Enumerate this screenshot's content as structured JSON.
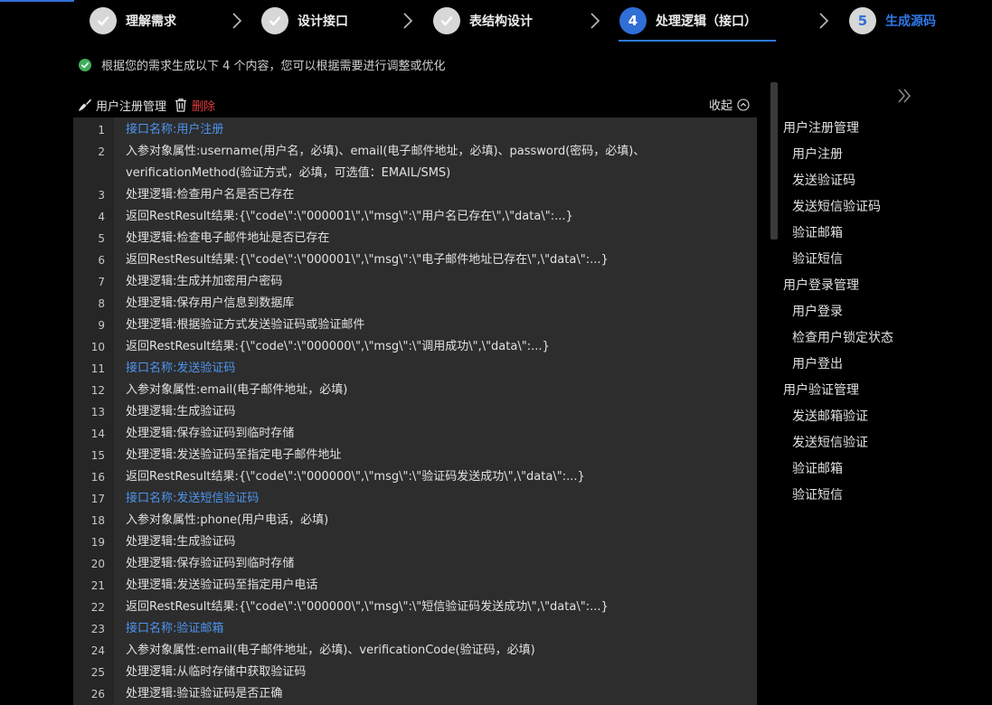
{
  "steps": [
    {
      "label": "理解需求",
      "state": "done"
    },
    {
      "label": "设计接口",
      "state": "done"
    },
    {
      "label": "表结构设计",
      "state": "done"
    },
    {
      "label": "处理逻辑（接口）",
      "number": "4",
      "state": "active"
    },
    {
      "label": "生成源码",
      "number": "5",
      "state": "todo"
    }
  ],
  "status": {
    "text": "根据您的需求生成以下 4 个内容，您可以根据需要进行调整或优化"
  },
  "toolbar": {
    "manage_label": "用户注册管理",
    "delete_label": "删除",
    "collapse_label": "收起"
  },
  "code_lines": [
    {
      "n": "1",
      "text": "接口名称:用户注册",
      "type": "name"
    },
    {
      "n": "2",
      "text": "入参对象属性:username(用户名，必填)、email(电子邮件地址，必填)、password(密码，必填)、verificationMethod(验证方式，必填，可选值：EMAIL/SMS)"
    },
    {
      "n": "3",
      "text": "处理逻辑:检查用户名是否已存在"
    },
    {
      "n": "4",
      "text": "返回RestResult结果:{\\\"code\\\":\\\"000001\\\",\\\"msg\\\":\\\"用户名已存在\\\",\\\"data\\\":...}"
    },
    {
      "n": "5",
      "text": "处理逻辑:检查电子邮件地址是否已存在"
    },
    {
      "n": "6",
      "text": "返回RestResult结果:{\\\"code\\\":\\\"000001\\\",\\\"msg\\\":\\\"电子邮件地址已存在\\\",\\\"data\\\":...}"
    },
    {
      "n": "7",
      "text": "处理逻辑:生成并加密用户密码"
    },
    {
      "n": "8",
      "text": "处理逻辑:保存用户信息到数据库"
    },
    {
      "n": "9",
      "text": "处理逻辑:根据验证方式发送验证码或验证邮件"
    },
    {
      "n": "10",
      "text": "返回RestResult结果:{\\\"code\\\":\\\"000000\\\",\\\"msg\\\":\\\"调用成功\\\",\\\"data\\\":...}"
    },
    {
      "n": "11",
      "text": "接口名称:发送验证码",
      "type": "name"
    },
    {
      "n": "12",
      "text": "入参对象属性:email(电子邮件地址，必填)"
    },
    {
      "n": "13",
      "text": "处理逻辑:生成验证码"
    },
    {
      "n": "14",
      "text": "处理逻辑:保存验证码到临时存储"
    },
    {
      "n": "15",
      "text": "处理逻辑:发送验证码至指定电子邮件地址"
    },
    {
      "n": "16",
      "text": "返回RestResult结果:{\\\"code\\\":\\\"000000\\\",\\\"msg\\\":\\\"验证码发送成功\\\",\\\"data\\\":...}"
    },
    {
      "n": "17",
      "text": "接口名称:发送短信验证码",
      "type": "name"
    },
    {
      "n": "18",
      "text": "入参对象属性:phone(用户电话，必填)"
    },
    {
      "n": "19",
      "text": "处理逻辑:生成验证码"
    },
    {
      "n": "20",
      "text": "处理逻辑:保存验证码到临时存储"
    },
    {
      "n": "21",
      "text": "处理逻辑:发送验证码至指定用户电话"
    },
    {
      "n": "22",
      "text": "返回RestResult结果:{\\\"code\\\":\\\"000000\\\",\\\"msg\\\":\\\"短信验证码发送成功\\\",\\\"data\\\":...}"
    },
    {
      "n": "23",
      "text": "接口名称:验证邮箱",
      "type": "name"
    },
    {
      "n": "24",
      "text": "入参对象属性:email(电子邮件地址，必填)、verificationCode(验证码，必填)"
    },
    {
      "n": "25",
      "text": "处理逻辑:从临时存储中获取验证码"
    },
    {
      "n": "26",
      "text": "处理逻辑:验证验证码是否正确"
    }
  ],
  "sidebar": {
    "groups": [
      {
        "title": "用户注册管理",
        "items": [
          "用户注册",
          "发送验证码",
          "发送短信验证码",
          "验证邮箱",
          "验证短信"
        ]
      },
      {
        "title": "用户登录管理",
        "items": [
          "用户登录",
          "检查用户锁定状态",
          "用户登出"
        ]
      },
      {
        "title": "用户验证管理",
        "items": [
          "发送邮箱验证",
          "发送短信验证",
          "验证邮箱",
          "验证短信"
        ]
      }
    ]
  },
  "colors": {
    "accent": "#2f78e6",
    "danger": "#e23b3b",
    "success": "#3fae5a",
    "editor_bg": "#2d2d2d"
  }
}
